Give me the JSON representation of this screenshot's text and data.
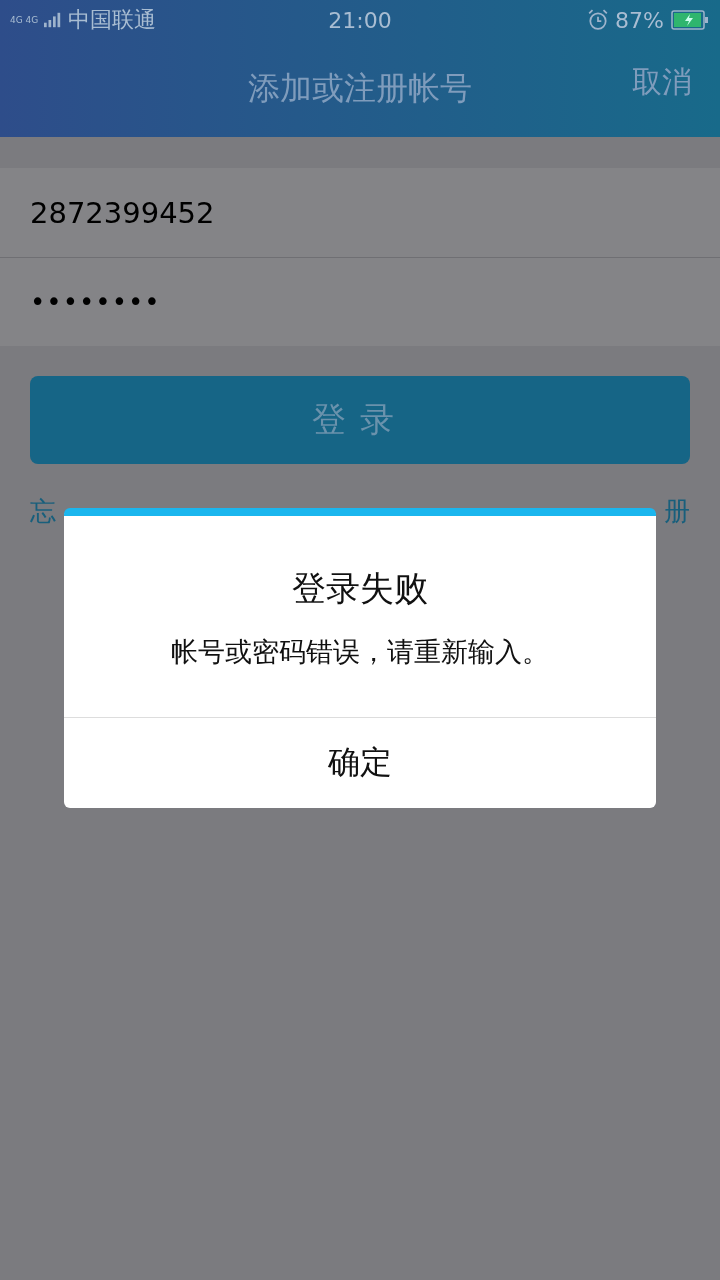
{
  "status_bar": {
    "network": "4G 4G",
    "carrier": "中国联通",
    "time": "21:00",
    "battery": "87%"
  },
  "header": {
    "title": "添加或注册帐号",
    "cancel": "取消"
  },
  "form": {
    "account": {
      "value": "2872399452"
    },
    "password": {
      "value": "••••••••"
    }
  },
  "login_button": "登录",
  "links": {
    "forgot": "忘",
    "register": "册"
  },
  "dialog": {
    "title": "登录失败",
    "message": "帐号或密码错误，请重新输入。",
    "button": "确定"
  }
}
